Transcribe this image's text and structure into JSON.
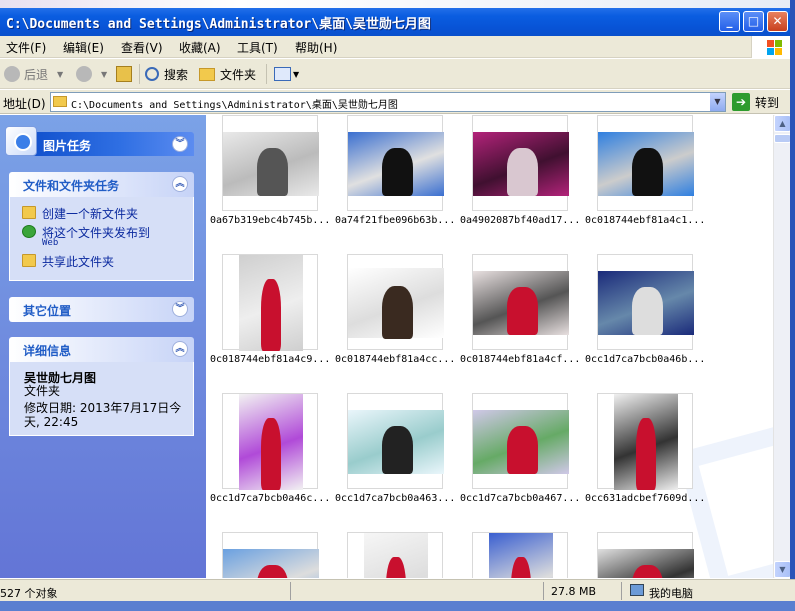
{
  "window": {
    "title": "C:\\Documents and Settings\\Administrator\\桌面\\吴世勋七月图",
    "buttons": {
      "minimize": "_",
      "maximize": "□",
      "close": "✕"
    }
  },
  "menu": [
    "文件(F)",
    "编辑(E)",
    "查看(V)",
    "收藏(A)",
    "工具(T)",
    "帮助(H)"
  ],
  "toolbar": {
    "back": "后退",
    "search": "搜索",
    "folders": "文件夹"
  },
  "address": {
    "label": "地址(D)",
    "path": "C:\\Documents and Settings\\Administrator\\桌面\\吴世勋七月图",
    "go": "转到"
  },
  "panels": {
    "picture_tasks": {
      "title": "图片任务"
    },
    "file_tasks": {
      "title": "文件和文件夹任务",
      "items": [
        "创建一个新文件夹",
        "将这个文件夹发布到",
        "Web",
        "共享此文件夹"
      ]
    },
    "other_places": {
      "title": "其它位置"
    },
    "details": {
      "title": "详细信息",
      "name": "吴世勋七月图",
      "type": "文件夹",
      "modified_1": "修改日期: 2013年7月17日今",
      "modified_2": "天, 22:45"
    }
  },
  "files": [
    "0a67b319ebc4b745b...",
    "0a74f21fbe096b63b...",
    "0a4902087bf40ad17...",
    "0c018744ebf81a4c1...",
    "0c018744ebf81a4c9...",
    "0c018744ebf81a4cc...",
    "0c018744ebf81a4cf...",
    "0cc1d7ca7bcb0a46b...",
    "0cc1d7ca7bcb0a46c...",
    "0cc1d7ca7bcb0a463...",
    "0cc1d7ca7bcb0a467...",
    "0cc631adcbef7609d...",
    "",
    "",
    "",
    ""
  ],
  "status": {
    "objects": "527 个对象",
    "size": "27.8 MB",
    "location": "我的电脑"
  },
  "colors": {
    "title_bar": "#0a5de0",
    "left_pane": "#6f8fe0",
    "link": "#0b2a9f"
  }
}
